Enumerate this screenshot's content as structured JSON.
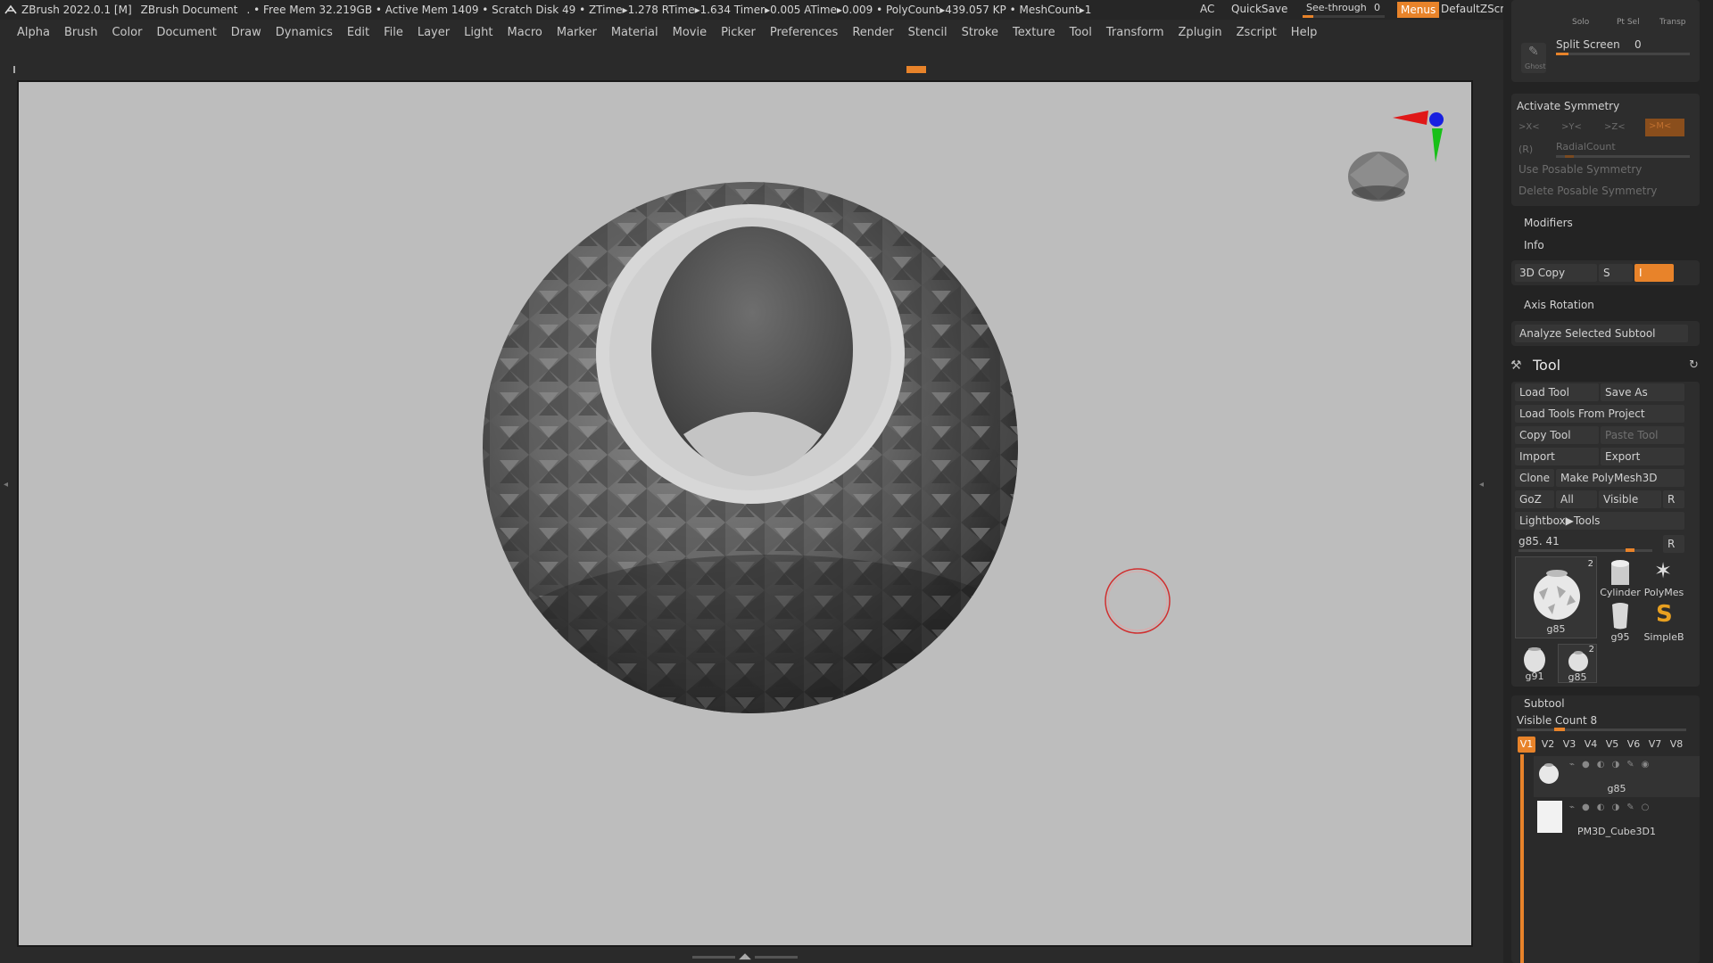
{
  "titlebar": {
    "app": "ZBrush 2022.0.1 [M]",
    "document": "ZBrush Document",
    "stats": ". • Free Mem 32.219GB • Active Mem 1409 • Scratch Disk 49 •  ZTime▸1.278 RTime▸1.634 Timer▸0.005 ATime▸0.009 • PolyCount▸439.057 KP  • MeshCount▸1",
    "ac": "AC",
    "quicksave": "QuickSave",
    "see_through_label": "See-through",
    "see_through_value": "0",
    "see_through_level": 0,
    "menus": "Menus",
    "zscript": "DefaultZScript"
  },
  "menubar": [
    "Alpha",
    "Brush",
    "Color",
    "Document",
    "Draw",
    "Dynamics",
    "Edit",
    "File",
    "Layer",
    "Light",
    "Macro",
    "Marker",
    "Material",
    "Movie",
    "Picker",
    "Preferences",
    "Render",
    "Stencil",
    "Stroke",
    "Texture",
    "Tool",
    "Transform",
    "Zplugin",
    "Zscript",
    "Help"
  ],
  "rpanel": {
    "top": {
      "solo": "Solo",
      "ptsel": "Pt Sel",
      "transp": "Transp",
      "ghost": "Ghost",
      "split_screen": "Split Screen",
      "split_screen_value": "0"
    },
    "symmetry": {
      "title": "Activate Symmetry",
      "x": ">X<",
      "y": ">Y<",
      "z": ">Z<",
      "m": ">M<",
      "r": "(R)",
      "radial": "RadialCount",
      "posable": "Use Posable Symmetry",
      "delete_posable": "Delete Posable Symmetry"
    },
    "modifiers": "Modifiers",
    "info": "Info",
    "copy3d": "3D Copy",
    "copy3d_s": "S",
    "copy3d_i": "I",
    "axis_rotation": "Axis Rotation",
    "analyze": "Analyze Selected Subtool",
    "tool": {
      "title": "Tool",
      "load_tool": "Load Tool",
      "save_as": "Save As",
      "load_from_project": "Load Tools From Project",
      "copy_tool": "Copy Tool",
      "paste_tool": "Paste Tool",
      "import": "Import",
      "export": "Export",
      "clone": "Clone",
      "make_polymesh": "Make PolyMesh3D",
      "goz": "GoZ",
      "all": "All",
      "visible": "Visible",
      "r": "R",
      "lightbox": "Lightbox▶Tools",
      "current": "g85. 41",
      "current_r": "R",
      "thumbs": {
        "main": "g85",
        "main_count": "2",
        "cylinder": "Cylinder",
        "polymesh": "PolyMes",
        "g95": "g95",
        "simpleb": "SimpleB",
        "g91": "g91",
        "g85b": "g85",
        "g85b_count": "2"
      }
    },
    "subtool": {
      "title": "Subtool",
      "visible_count": "Visible Count 8",
      "tabs": [
        "V1",
        "V2",
        "V3",
        "V4",
        "V5",
        "V6",
        "V7",
        "V8"
      ],
      "items": [
        "g85",
        "PM3D_Cube3D1"
      ]
    }
  },
  "colors": {
    "accent": "#e8832a",
    "canvas": "#bdbdbd",
    "panel": "#232323",
    "gyro_x": "#e01818",
    "gyro_y": "#18c018",
    "gyro_z": "#1820e0",
    "brush_cursor": "#d03030"
  },
  "icons": [
    "zbrush-logo-icon",
    "hammer-icon",
    "refresh-icon",
    "gizmo-axis-icon",
    "brush-cursor-icon"
  ]
}
